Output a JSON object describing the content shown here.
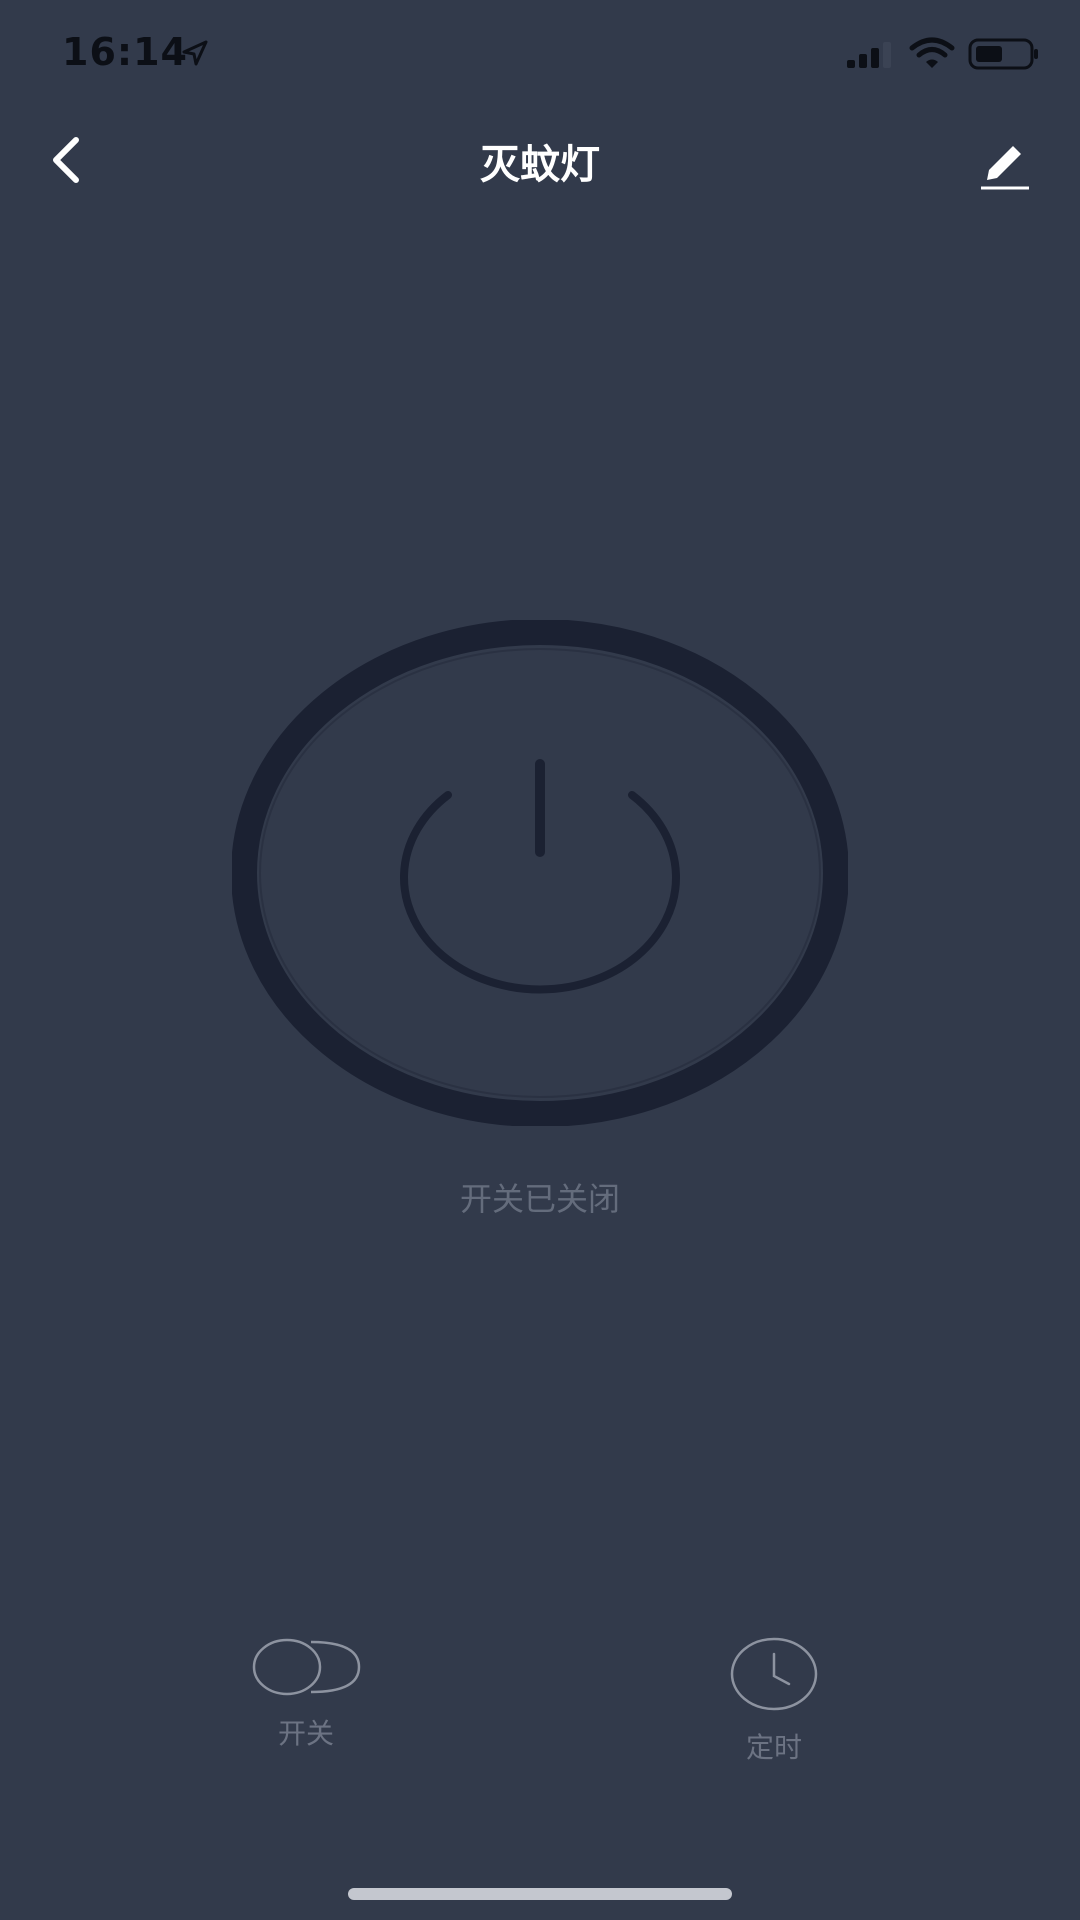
{
  "status_bar": {
    "time": "16:14",
    "icons": [
      "location-arrow-icon",
      "cellular-signal-icon",
      "wifi-icon",
      "battery-icon"
    ]
  },
  "nav": {
    "title": "灭蚊灯",
    "back_icon": "chevron-left-icon",
    "edit_icon": "pencil-icon"
  },
  "power": {
    "icon": "power-icon",
    "status": "开关已关闭"
  },
  "controls": [
    {
      "label": "开关",
      "icon": "toggle-switch-icon"
    },
    {
      "label": "定时",
      "icon": "clock-icon"
    }
  ],
  "colors": {
    "background": "#323a4b",
    "ring": "#1b2132",
    "muted_text": "#646c7c",
    "title": "#ffffff"
  }
}
